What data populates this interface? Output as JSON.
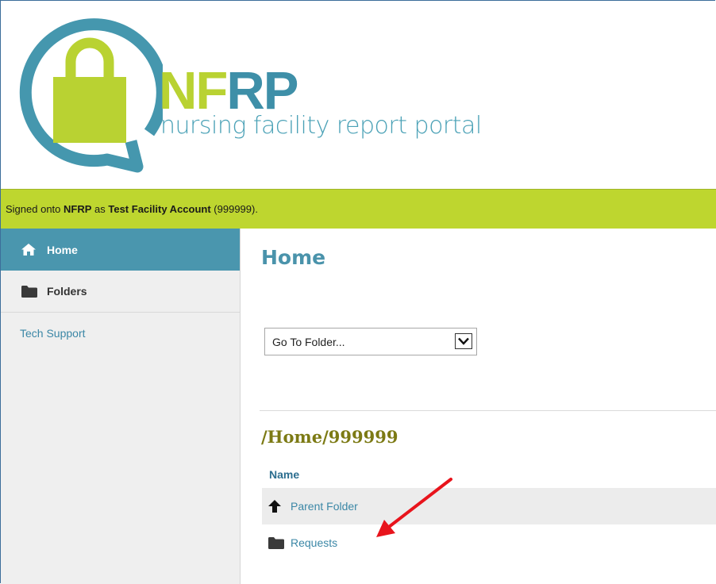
{
  "header": {
    "logo_nf": "NF",
    "logo_rp": "RP",
    "tagline": "nursing facility report portal"
  },
  "status": {
    "prefix": "Signed onto ",
    "app": "NFRP",
    "middle": " as ",
    "account": "Test Facility Account",
    "account_id": " (999999)."
  },
  "sidebar": {
    "items": [
      {
        "label": "Home",
        "icon": "home-icon",
        "active": true
      },
      {
        "label": "Folders",
        "icon": "folder-icon",
        "active": false
      }
    ],
    "tech_support": "Tech Support"
  },
  "main": {
    "title": "Home",
    "folder_select": {
      "selected": "Go To Folder..."
    },
    "path": "/Home/999999",
    "table": {
      "column_name": "Name",
      "rows": [
        {
          "label": "Parent Folder",
          "icon": "arrow-up-icon"
        },
        {
          "label": "Requests",
          "icon": "folder-icon"
        }
      ]
    }
  },
  "colors": {
    "accent_teal": "#4a96ae",
    "status_green": "#bed62f",
    "logo_green": "#b9d232",
    "logo_teal": "#3e8fa8",
    "path_olive": "#7c7a14",
    "annotation_red": "#e8141c"
  }
}
